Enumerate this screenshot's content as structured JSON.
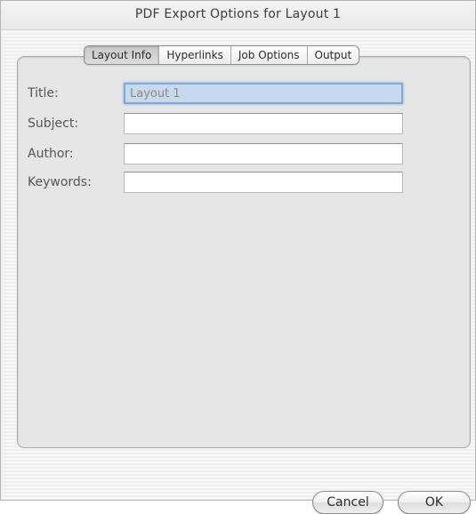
{
  "window": {
    "title": "PDF Export Options for Layout 1"
  },
  "tabs": [
    {
      "label": "Layout Info",
      "active": true
    },
    {
      "label": "Hyperlinks",
      "active": false
    },
    {
      "label": "Job Options",
      "active": false
    },
    {
      "label": "Output",
      "active": false
    }
  ],
  "form": {
    "title_label": "Title:",
    "title_value": "Layout 1",
    "subject_label": "Subject:",
    "subject_value": "",
    "author_label": "Author:",
    "author_value": "",
    "keywords_label": "Keywords:",
    "keywords_value": ""
  },
  "buttons": {
    "cancel_label": "Cancel",
    "ok_label": "OK"
  },
  "colors": {
    "focus_ring": "#7fa9d8",
    "selected_text_bg": "#c7d9ec"
  }
}
